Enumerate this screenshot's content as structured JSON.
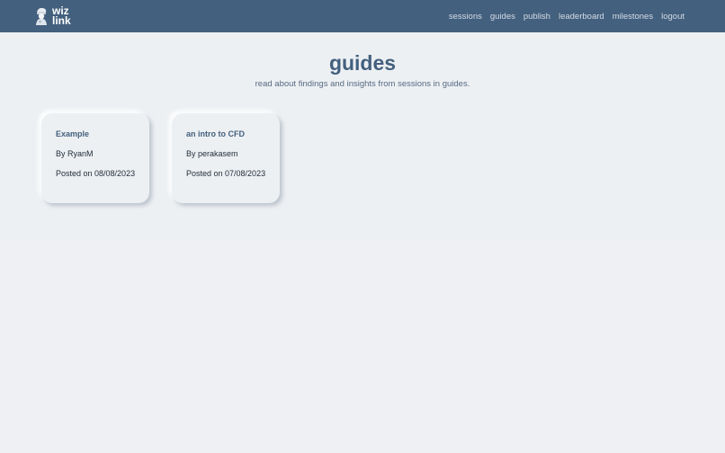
{
  "brand": {
    "line1": "wiz",
    "line2": "link"
  },
  "nav": {
    "links": [
      "sessions",
      "guides",
      "publish",
      "leaderboard",
      "milestones",
      "logout"
    ]
  },
  "page": {
    "title": "guides",
    "subtitle": "read about findings and insights from sessions in guides."
  },
  "guides": [
    {
      "title": "Example",
      "author": "By RyanM",
      "posted": "Posted on 08/08/2023"
    },
    {
      "title": "an intro to CFD",
      "author": "By perakasem",
      "posted": "Posted on 07/08/2023"
    }
  ],
  "colors": {
    "navbar": "#43607e",
    "accent": "#43607e",
    "background": "#edf0f3"
  }
}
